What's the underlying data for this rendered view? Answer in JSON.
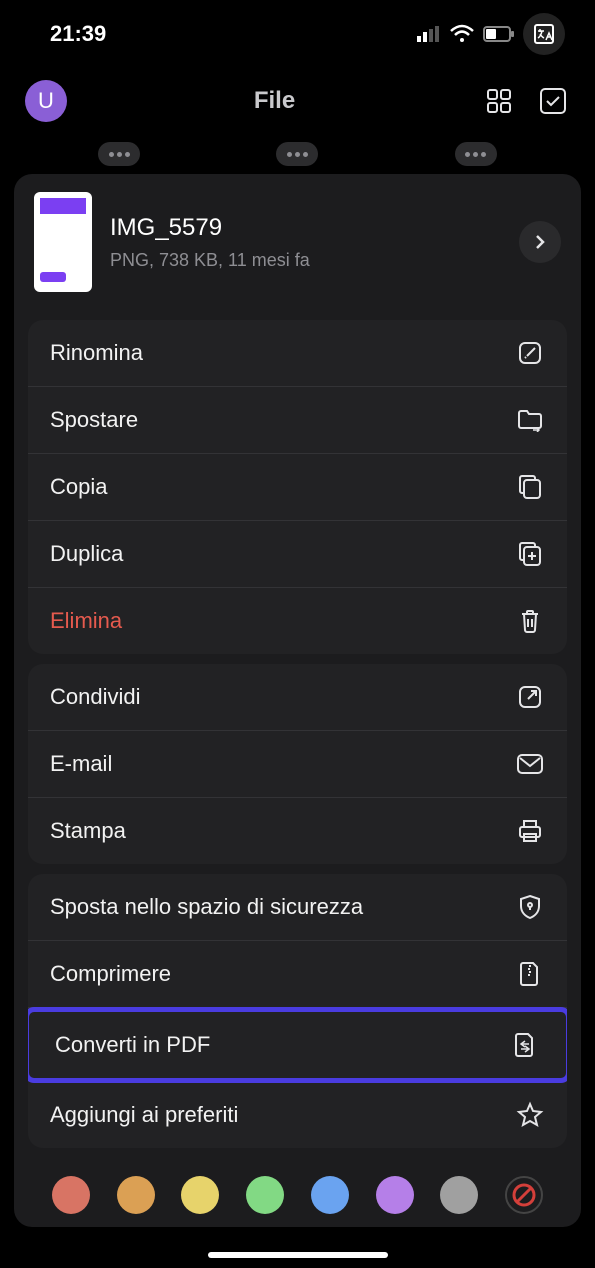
{
  "status": {
    "time": "21:39"
  },
  "header": {
    "avatar_letter": "U",
    "title": "File"
  },
  "file": {
    "name": "IMG_5579",
    "meta": "PNG, 738 KB, 11 mesi fa"
  },
  "group1": {
    "rename": "Rinomina",
    "move": "Spostare",
    "copy": "Copia",
    "duplicate": "Duplica",
    "delete": "Elimina"
  },
  "group2": {
    "share": "Condividi",
    "email": "E-mail",
    "print": "Stampa"
  },
  "group3": {
    "secure": "Sposta nello spazio di sicurezza",
    "compress": "Comprimere",
    "pdf": "Converti in PDF",
    "favorite": "Aggiungi ai preferiti"
  },
  "colors": [
    "#d87464",
    "#dba054",
    "#e7d36b",
    "#82d984",
    "#6aa3f0",
    "#b57fe8",
    "#a0a0a0"
  ]
}
